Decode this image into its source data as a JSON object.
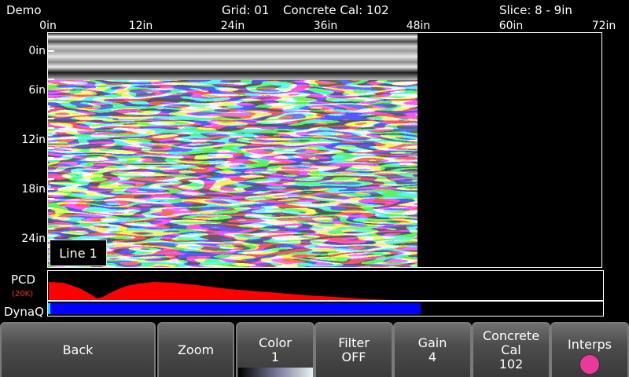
{
  "header": {
    "mode": "Demo",
    "grid": "Grid: 01",
    "concrete_cal": "Concrete Cal: 102",
    "slice": "Slice: 8 - 9in"
  },
  "horizontal_scale": [
    "0in",
    "12in",
    "24in",
    "36in",
    "48in",
    "60in",
    "72in"
  ],
  "vertical_scale": [
    "0in",
    "6in",
    "12in",
    "18in",
    "24in"
  ],
  "scan": {
    "line_label": "Line 1",
    "scanned_length_in": 48,
    "max_length_in": 72
  },
  "pcd": {
    "label": "PCD",
    "sublabel": "(20K)",
    "color": "#ff0000"
  },
  "dynaq": {
    "label": "DynaQ",
    "progress_fraction": 0.67,
    "bar_color": "#0000ff"
  },
  "buttons": {
    "back": {
      "label": "Back"
    },
    "zoom": {
      "label": "Zoom"
    },
    "color": {
      "label": "Color",
      "value": "1"
    },
    "filter": {
      "label": "Filter",
      "value": "OFF"
    },
    "gain": {
      "label": "Gain",
      "value": "4"
    },
    "concrete_cal": {
      "line1": "Concrete",
      "line2": "Cal",
      "value": "102"
    },
    "interps": {
      "label": "Interps",
      "indicator_color": "#e93a9a"
    }
  }
}
